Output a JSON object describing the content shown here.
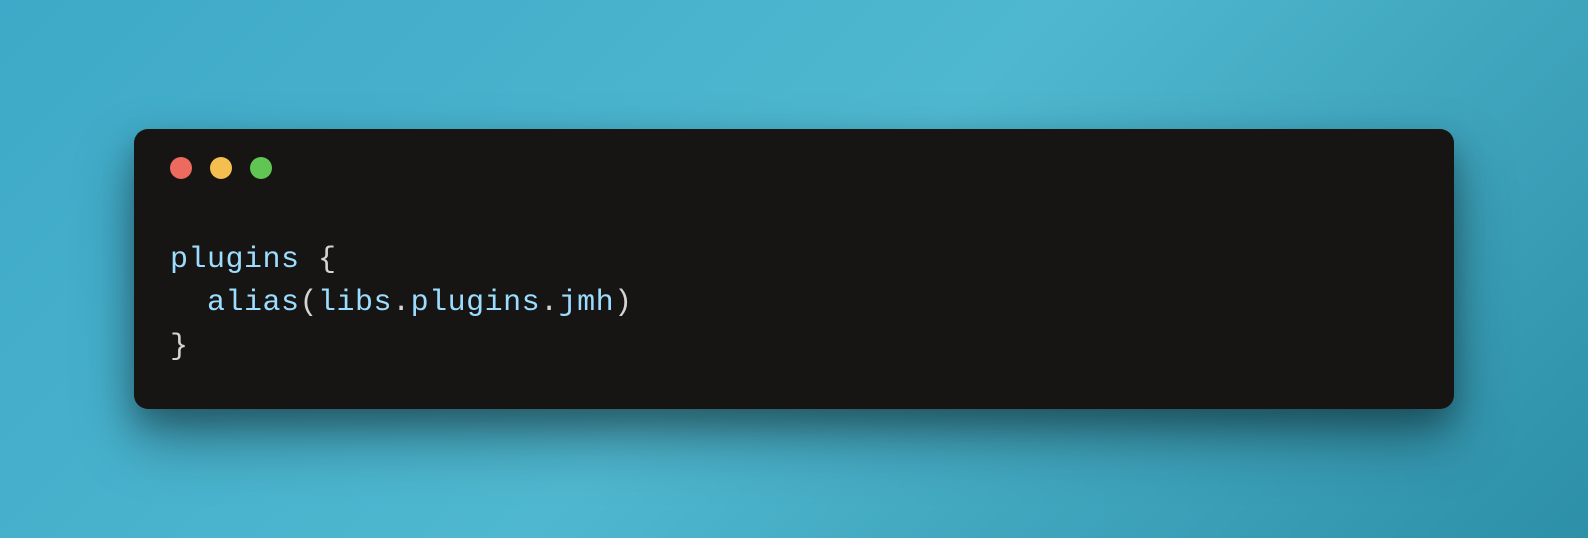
{
  "code": {
    "line1": {
      "keyword": "plugins",
      "brace_open": " {"
    },
    "line2": {
      "indent": "  ",
      "function": "alias",
      "paren_open": "(",
      "prop1": "libs",
      "dot1": ".",
      "prop2": "plugins",
      "dot2": ".",
      "prop3": "jmh",
      "paren_close": ")"
    },
    "line3": {
      "brace_close": "}"
    }
  },
  "window": {
    "traffic_lights": {
      "red": "#ed6a5e",
      "yellow": "#f5bf4f",
      "green": "#61c554"
    }
  }
}
